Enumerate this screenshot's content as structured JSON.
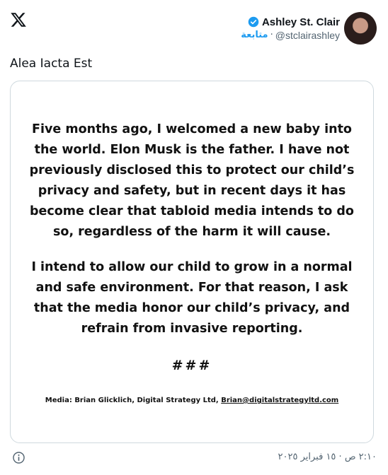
{
  "author": {
    "name": "Ashley St. Clair",
    "follow_label": "متابعة",
    "separator": "·",
    "handle": "@stclairashley"
  },
  "post": {
    "caption": "Alea Iacta Est",
    "statement_p1": "Five months ago, I welcomed a new baby into the world. Elon Musk is the father. I have not previously disclosed this to protect our child’s privacy and safety, but in recent days it has become clear that tabloid media intends to do so, regardless of the harm it will cause.",
    "statement_p2": "I intend to allow our child to grow in a normal and safe environment. For that reason, I ask that the media honor our child’s privacy, and refrain from invasive reporting.",
    "hashes": "###",
    "contact_prefix": "Media: Brian Glicklich, Digital Strategy Ltd,",
    "contact_email": "Brian@digitalstrategyltd.com"
  },
  "footer": {
    "timestamp": "٢:١٠ ص · ١٥ فبراير ٢٠٢٥"
  },
  "colors": {
    "accent": "#1d9bf0",
    "secondary_text": "#536471",
    "border": "#cfd9de"
  },
  "icons": [
    "x-logo-icon",
    "verified-badge-icon",
    "info-icon"
  ]
}
